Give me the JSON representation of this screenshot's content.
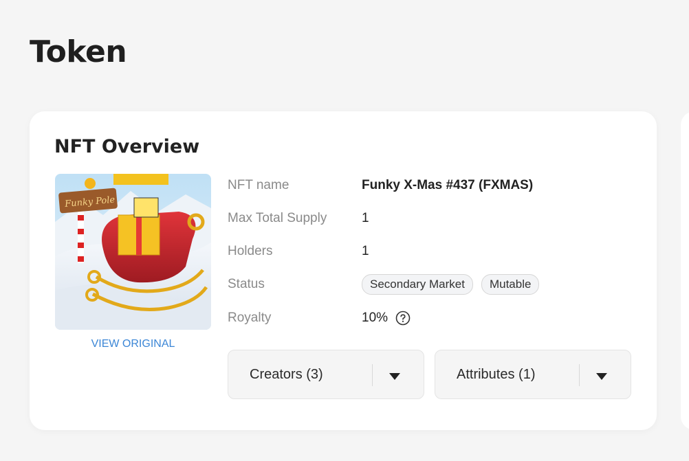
{
  "page": {
    "title": "Token"
  },
  "overview": {
    "title": "NFT Overview",
    "image_alt": "Funky Pole",
    "view_original": "VIEW ORIGINAL",
    "fields": {
      "name_label": "NFT name",
      "name_value": "Funky X-Mas #437 (FXMAS)",
      "supply_label": "Max Total Supply",
      "supply_value": "1",
      "holders_label": "Holders",
      "holders_value": "1",
      "status_label": "Status",
      "status_chips": [
        "Secondary Market",
        "Mutable"
      ],
      "royalty_label": "Royalty",
      "royalty_value": "10%"
    },
    "dropdowns": {
      "creators": "Creators (3)",
      "attributes": "Attributes (1)"
    }
  },
  "colors": {
    "link": "#3b86d6",
    "background": "#f5f5f5",
    "card": "#ffffff"
  }
}
